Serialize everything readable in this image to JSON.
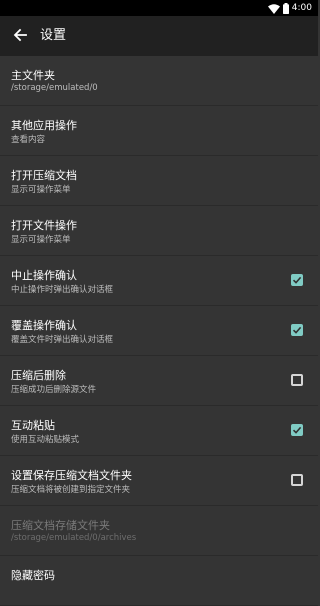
{
  "status_bar": {
    "time": "4:00",
    "wifi_icon": "wifi-icon",
    "battery_icon": "battery-icon"
  },
  "toolbar": {
    "back_icon": "arrow-back-icon",
    "title": "设置"
  },
  "colors": {
    "background": "#343434",
    "toolbar": "#212121",
    "accent": "#80cbc4"
  },
  "settings": [
    {
      "title": "主文件夹",
      "subtitle": "/storage/emulated/0"
    },
    {
      "title": "其他应用操作",
      "subtitle": "查看内容"
    },
    {
      "title": "打开压缩文档",
      "subtitle": "显示可操作菜单"
    },
    {
      "title": "打开文件操作",
      "subtitle": "显示可操作菜单"
    },
    {
      "title": "中止操作确认",
      "subtitle": "中止操作时弹出确认对话框",
      "checked": true
    },
    {
      "title": "覆盖操作确认",
      "subtitle": "覆盖文件时弹出确认对话框",
      "checked": true
    },
    {
      "title": "压缩后删除",
      "subtitle": "压缩成功后删除源文件",
      "checked": false
    },
    {
      "title": "互动粘贴",
      "subtitle": "使用互动粘贴模式",
      "checked": true
    },
    {
      "title": "设置保存压缩文档文件夹",
      "subtitle": "压缩文档将被创建到指定文件夹",
      "checked": false
    },
    {
      "title": "压缩文档存储文件夹",
      "subtitle": "/storage/emulated/0/archives",
      "disabled": true
    },
    {
      "title": "隐藏密码"
    }
  ]
}
